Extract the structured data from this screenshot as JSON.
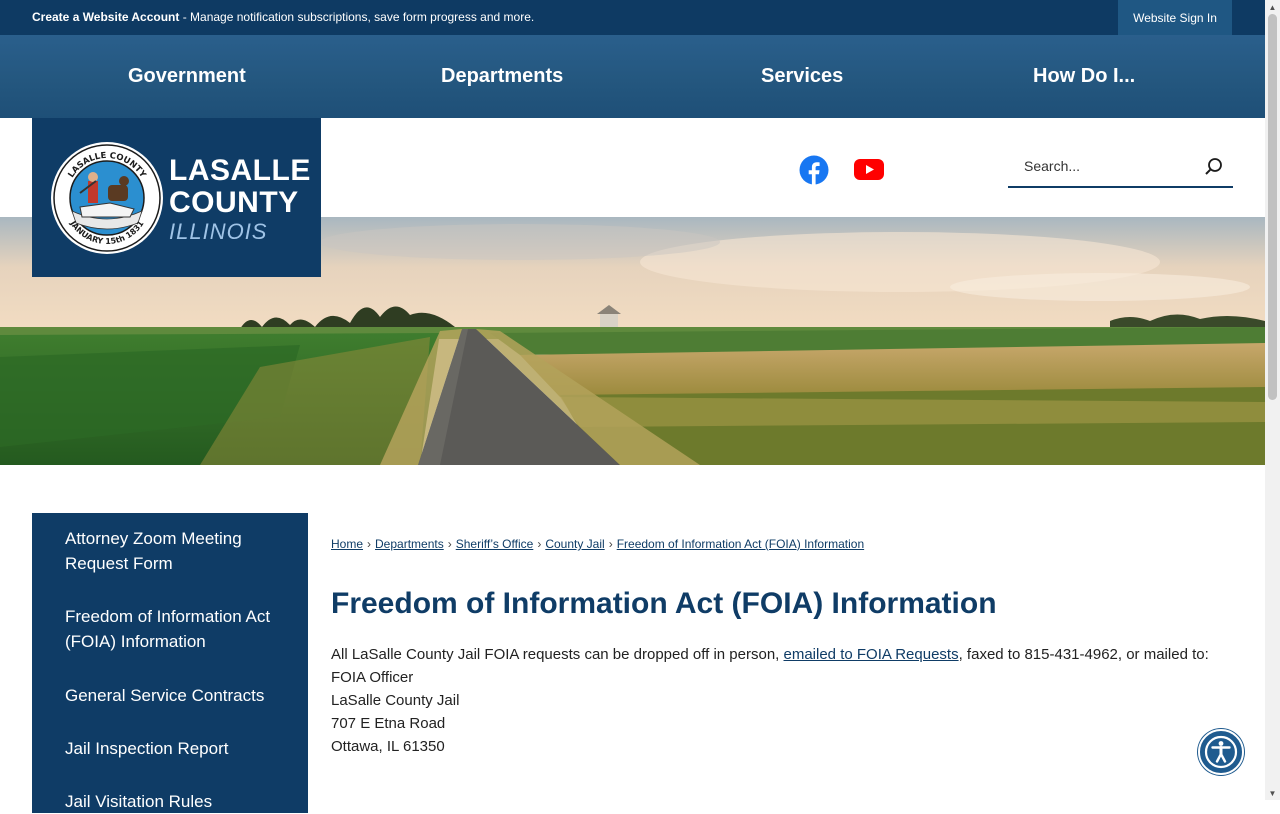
{
  "topbar": {
    "create_account": "Create a Website Account",
    "message": " - Manage notification subscriptions, save form progress and more.",
    "sign_in": "Website Sign In"
  },
  "nav": {
    "items": [
      {
        "label": "Government"
      },
      {
        "label": "Departments"
      },
      {
        "label": "Services"
      },
      {
        "label": "How Do I..."
      }
    ]
  },
  "logo": {
    "line1": "LASALLE",
    "line2": "COUNTY",
    "line3": "ILLINOIS",
    "seal_top": "LASALLE COUNTY",
    "seal_bottom": "JANUARY 15th 1831"
  },
  "social": [
    {
      "name": "facebook-icon",
      "color": "#1877f2"
    },
    {
      "name": "youtube-icon",
      "color": "#ff0000"
    }
  ],
  "search": {
    "placeholder": "Search..."
  },
  "sidebar": {
    "items": [
      {
        "label": "Attorney Zoom Meeting Request Form"
      },
      {
        "label": "Freedom of Information Act (FOIA) Information"
      },
      {
        "label": "General Service Contracts"
      },
      {
        "label": "Jail Inspection Report"
      },
      {
        "label": "Jail Visitation Rules"
      }
    ]
  },
  "breadcrumb": [
    {
      "label": "Home"
    },
    {
      "label": "Departments"
    },
    {
      "label": "Sheriff’s Office"
    },
    {
      "label": "County Jail"
    },
    {
      "label": "Freedom of Information Act (FOIA) Information"
    }
  ],
  "page": {
    "title": "Freedom of Information Act (FOIA) Information",
    "intro_before": "All LaSalle County Jail FOIA requests can be dropped off in person, ",
    "intro_link": "emailed to FOIA Requests",
    "intro_after": ", faxed to 815-431-4962, or mailed to:",
    "address": [
      "FOIA Officer",
      "LaSalle County Jail",
      "707 E Etna Road",
      "Ottawa, IL 61350"
    ]
  },
  "colors": {
    "brand_navy": "#0f3c66",
    "topbar": "#0e3a63",
    "nav": "#24577f"
  }
}
